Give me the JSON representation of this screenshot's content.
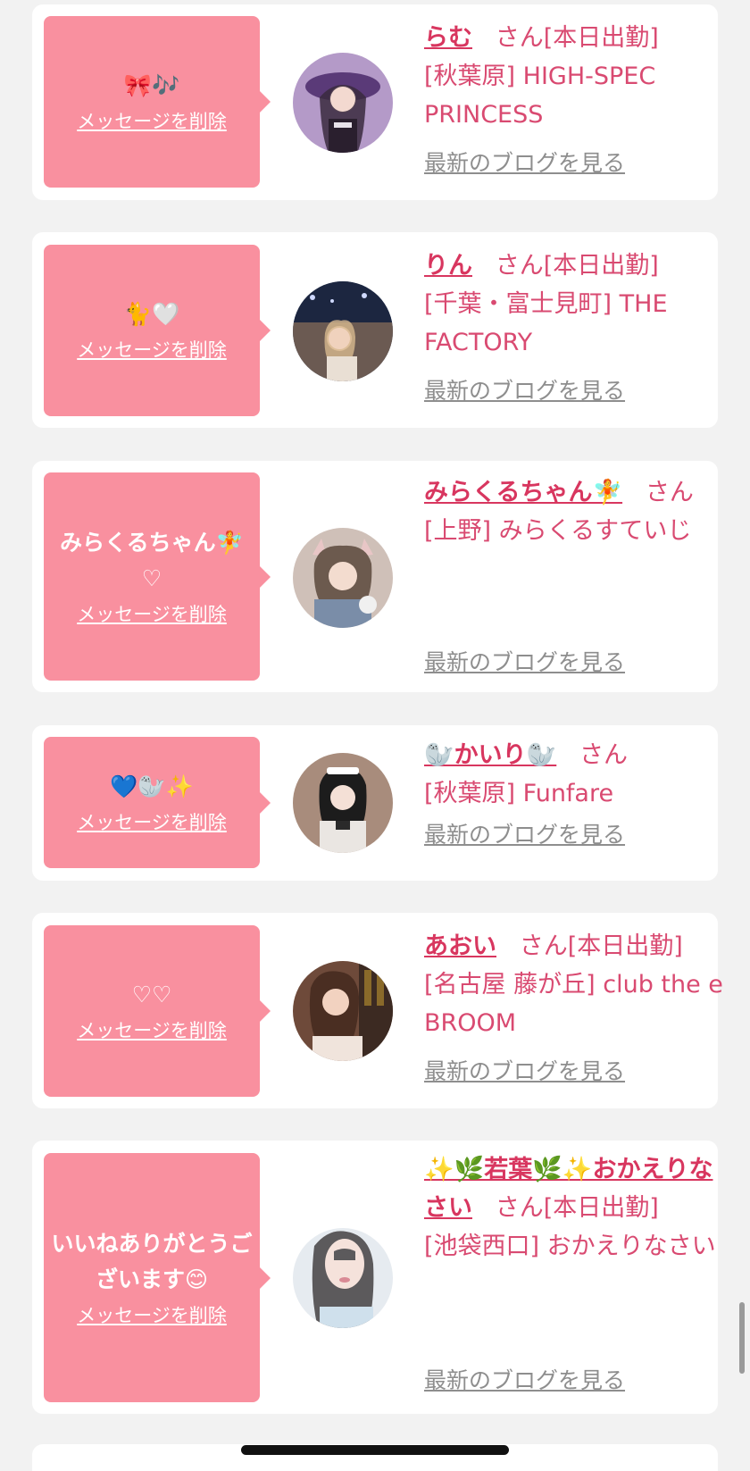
{
  "cards": [
    {
      "message": "🎀🎶",
      "delete_label": "メッセージを削除",
      "name": "らむ",
      "suffix": "さん[本日出勤]",
      "shop": "[秋葉原] HIGH-SPEC PRINCESS",
      "blog_label": "最新のブログを見る"
    },
    {
      "message": "🐈🤍",
      "delete_label": "メッセージを削除",
      "name": "りん",
      "suffix": "さん[本日出勤]",
      "shop": "[千葉・富士見町] THE FACTORY",
      "blog_label": "最新のブログを見る"
    },
    {
      "message": "みらくるちゃん🧚 ♡",
      "delete_label": "メッセージを削除",
      "name": "みらくるちゃん🧚",
      "suffix": "さん",
      "shop": "[上野] みらくるすていじ",
      "blog_label": "最新のブログを見る"
    },
    {
      "message": "💙🦭✨",
      "delete_label": "メッセージを削除",
      "name": "🦭かいり🦭",
      "suffix": "さん",
      "shop": "[秋葉原] Funfare",
      "blog_label": "最新のブログを見る"
    },
    {
      "message": "♡♡",
      "delete_label": "メッセージを削除",
      "name": "あおい",
      "suffix": "さん[本日出勤]",
      "shop": "[名古屋 藤が丘] club the e BROOM",
      "blog_label": "最新のブログを見る"
    },
    {
      "message": "いいねありがとうございます😊",
      "delete_label": "メッセージを削除",
      "name": "✨🌿若葉🌿✨おかえりなさい",
      "suffix": "さん[本日出勤]",
      "shop": "[池袋西口] おかえりなさい",
      "blog_label": "最新のブログを見る"
    }
  ]
}
